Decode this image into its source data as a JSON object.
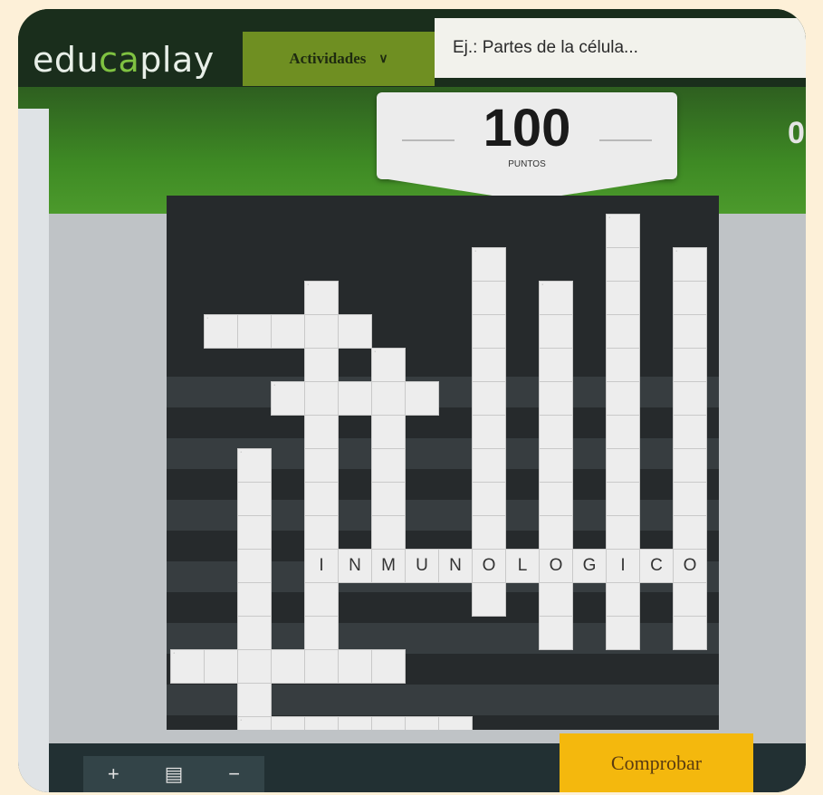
{
  "header": {
    "logo_prefix": "edu",
    "logo_accent": "ca",
    "logo_suffix": "play",
    "activities_label": "Actividades",
    "activities_icon": "chevron-down-icon",
    "search_placeholder": "Ej.: Partes de la célula..."
  },
  "score": {
    "value": "100",
    "label": "PUNTOS",
    "secondary_value": "0"
  },
  "crossword": {
    "answer_word": [
      "I",
      "N",
      "M",
      "U",
      "N",
      "O",
      "L",
      "O",
      "G",
      "I",
      "C",
      "O"
    ],
    "cell_color": "#ededed",
    "board_color": "#262a2c"
  },
  "controls": {
    "zoom_in": "+",
    "zoom_fit_icon": "fit-screen-icon",
    "zoom_out": "−",
    "check_button": "Comprobar"
  },
  "colors": {
    "topbar": "#1a2e1c",
    "accent_green": "#7fc241",
    "activities_bg": "#6f8f22",
    "check_button_bg": "#f4b80d"
  }
}
